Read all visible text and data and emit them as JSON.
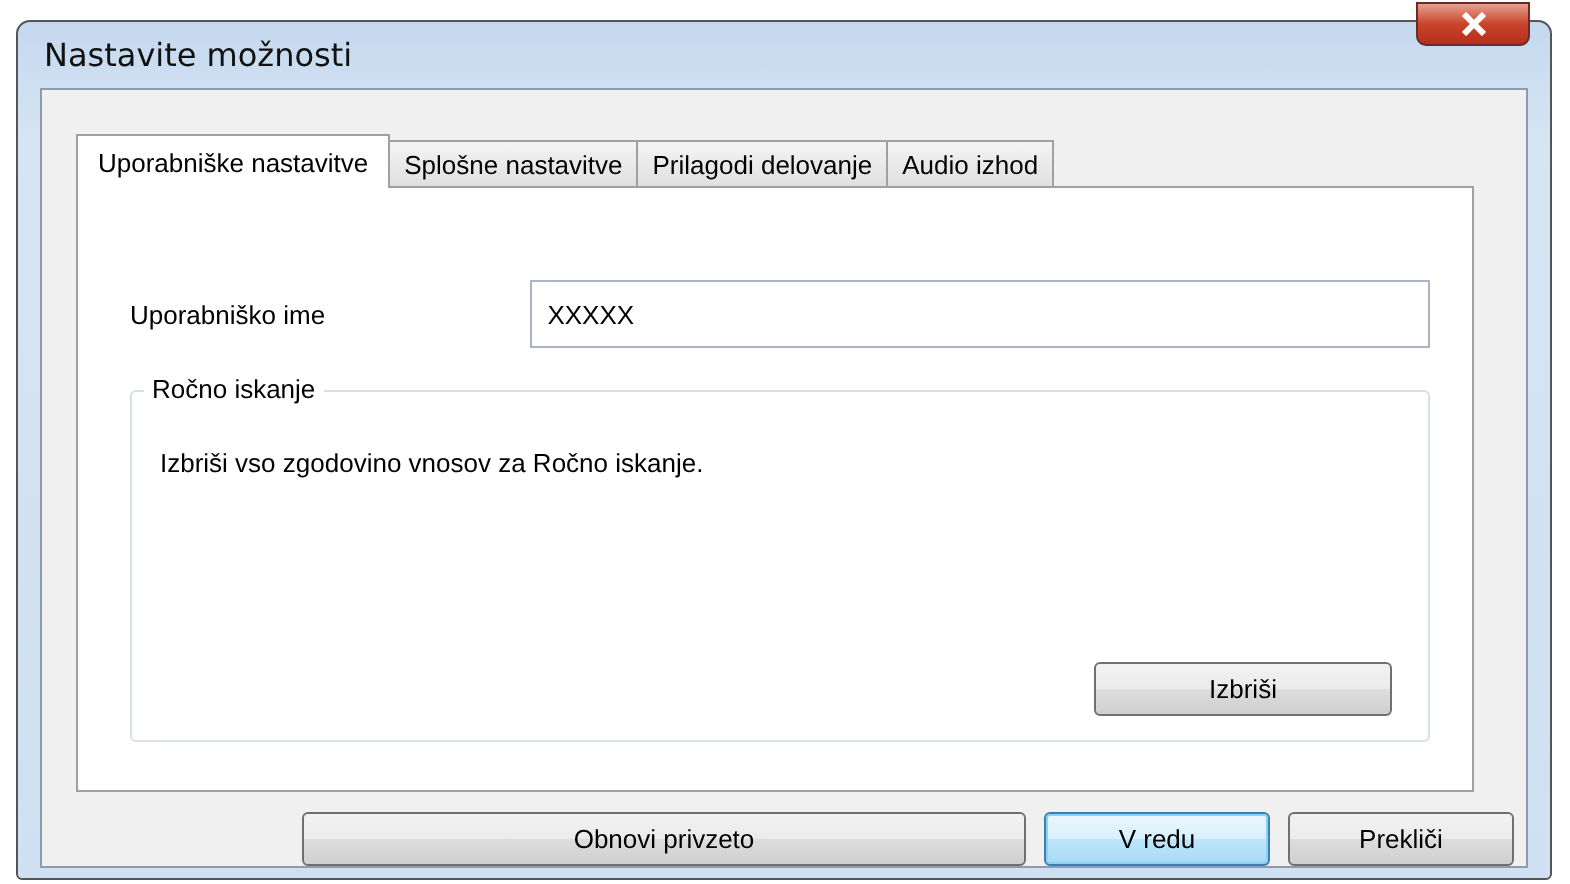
{
  "window": {
    "title": "Nastavite možnosti"
  },
  "tabs": [
    {
      "label": "Uporabniške nastavitve",
      "selected": true
    },
    {
      "label": "Splošne nastavitve",
      "selected": false
    },
    {
      "label": "Prilagodi delovanje",
      "selected": false
    },
    {
      "label": "Audio izhod",
      "selected": false
    }
  ],
  "username": {
    "label": "Uporabniško ime",
    "value": "XXXXX"
  },
  "group": {
    "title": "Ročno iskanje",
    "text": "Izbriši vso zgodovino vnosov za Ročno iskanje.",
    "button": "Izbriši"
  },
  "buttons": [
    {
      "label": "Obnovi privzeto",
      "kind": "wide",
      "selected": false
    },
    {
      "label": "V redu",
      "kind": "normal",
      "selected": true
    },
    {
      "label": "Prekliči",
      "kind": "normal",
      "selected": false
    }
  ]
}
